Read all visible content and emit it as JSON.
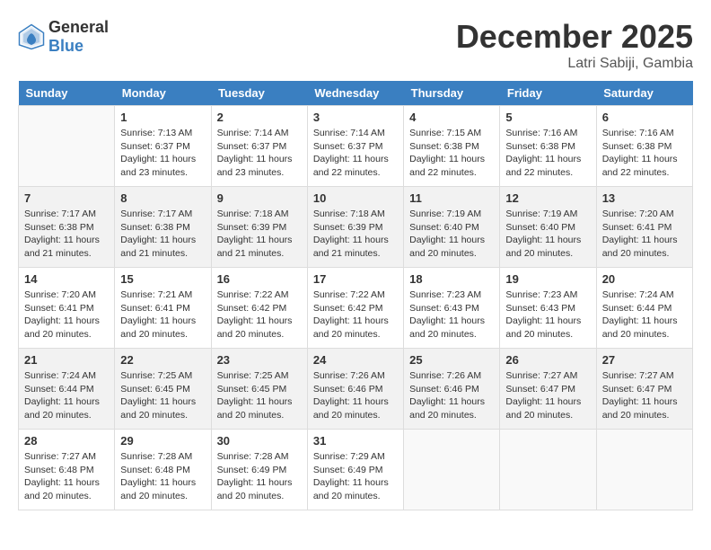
{
  "header": {
    "logo_general": "General",
    "logo_blue": "Blue",
    "month_year": "December 2025",
    "location": "Latri Sabiji, Gambia"
  },
  "weekdays": [
    "Sunday",
    "Monday",
    "Tuesday",
    "Wednesday",
    "Thursday",
    "Friday",
    "Saturday"
  ],
  "weeks": [
    [
      {
        "day": "",
        "sunrise": "",
        "sunset": "",
        "daylight": ""
      },
      {
        "day": "1",
        "sunrise": "Sunrise: 7:13 AM",
        "sunset": "Sunset: 6:37 PM",
        "daylight": "Daylight: 11 hours and 23 minutes."
      },
      {
        "day": "2",
        "sunrise": "Sunrise: 7:14 AM",
        "sunset": "Sunset: 6:37 PM",
        "daylight": "Daylight: 11 hours and 23 minutes."
      },
      {
        "day": "3",
        "sunrise": "Sunrise: 7:14 AM",
        "sunset": "Sunset: 6:37 PM",
        "daylight": "Daylight: 11 hours and 22 minutes."
      },
      {
        "day": "4",
        "sunrise": "Sunrise: 7:15 AM",
        "sunset": "Sunset: 6:38 PM",
        "daylight": "Daylight: 11 hours and 22 minutes."
      },
      {
        "day": "5",
        "sunrise": "Sunrise: 7:16 AM",
        "sunset": "Sunset: 6:38 PM",
        "daylight": "Daylight: 11 hours and 22 minutes."
      },
      {
        "day": "6",
        "sunrise": "Sunrise: 7:16 AM",
        "sunset": "Sunset: 6:38 PM",
        "daylight": "Daylight: 11 hours and 22 minutes."
      }
    ],
    [
      {
        "day": "7",
        "sunrise": "Sunrise: 7:17 AM",
        "sunset": "Sunset: 6:38 PM",
        "daylight": "Daylight: 11 hours and 21 minutes."
      },
      {
        "day": "8",
        "sunrise": "Sunrise: 7:17 AM",
        "sunset": "Sunset: 6:38 PM",
        "daylight": "Daylight: 11 hours and 21 minutes."
      },
      {
        "day": "9",
        "sunrise": "Sunrise: 7:18 AM",
        "sunset": "Sunset: 6:39 PM",
        "daylight": "Daylight: 11 hours and 21 minutes."
      },
      {
        "day": "10",
        "sunrise": "Sunrise: 7:18 AM",
        "sunset": "Sunset: 6:39 PM",
        "daylight": "Daylight: 11 hours and 21 minutes."
      },
      {
        "day": "11",
        "sunrise": "Sunrise: 7:19 AM",
        "sunset": "Sunset: 6:40 PM",
        "daylight": "Daylight: 11 hours and 20 minutes."
      },
      {
        "day": "12",
        "sunrise": "Sunrise: 7:19 AM",
        "sunset": "Sunset: 6:40 PM",
        "daylight": "Daylight: 11 hours and 20 minutes."
      },
      {
        "day": "13",
        "sunrise": "Sunrise: 7:20 AM",
        "sunset": "Sunset: 6:41 PM",
        "daylight": "Daylight: 11 hours and 20 minutes."
      }
    ],
    [
      {
        "day": "14",
        "sunrise": "Sunrise: 7:20 AM",
        "sunset": "Sunset: 6:41 PM",
        "daylight": "Daylight: 11 hours and 20 minutes."
      },
      {
        "day": "15",
        "sunrise": "Sunrise: 7:21 AM",
        "sunset": "Sunset: 6:41 PM",
        "daylight": "Daylight: 11 hours and 20 minutes."
      },
      {
        "day": "16",
        "sunrise": "Sunrise: 7:22 AM",
        "sunset": "Sunset: 6:42 PM",
        "daylight": "Daylight: 11 hours and 20 minutes."
      },
      {
        "day": "17",
        "sunrise": "Sunrise: 7:22 AM",
        "sunset": "Sunset: 6:42 PM",
        "daylight": "Daylight: 11 hours and 20 minutes."
      },
      {
        "day": "18",
        "sunrise": "Sunrise: 7:23 AM",
        "sunset": "Sunset: 6:43 PM",
        "daylight": "Daylight: 11 hours and 20 minutes."
      },
      {
        "day": "19",
        "sunrise": "Sunrise: 7:23 AM",
        "sunset": "Sunset: 6:43 PM",
        "daylight": "Daylight: 11 hours and 20 minutes."
      },
      {
        "day": "20",
        "sunrise": "Sunrise: 7:24 AM",
        "sunset": "Sunset: 6:44 PM",
        "daylight": "Daylight: 11 hours and 20 minutes."
      }
    ],
    [
      {
        "day": "21",
        "sunrise": "Sunrise: 7:24 AM",
        "sunset": "Sunset: 6:44 PM",
        "daylight": "Daylight: 11 hours and 20 minutes."
      },
      {
        "day": "22",
        "sunrise": "Sunrise: 7:25 AM",
        "sunset": "Sunset: 6:45 PM",
        "daylight": "Daylight: 11 hours and 20 minutes."
      },
      {
        "day": "23",
        "sunrise": "Sunrise: 7:25 AM",
        "sunset": "Sunset: 6:45 PM",
        "daylight": "Daylight: 11 hours and 20 minutes."
      },
      {
        "day": "24",
        "sunrise": "Sunrise: 7:26 AM",
        "sunset": "Sunset: 6:46 PM",
        "daylight": "Daylight: 11 hours and 20 minutes."
      },
      {
        "day": "25",
        "sunrise": "Sunrise: 7:26 AM",
        "sunset": "Sunset: 6:46 PM",
        "daylight": "Daylight: 11 hours and 20 minutes."
      },
      {
        "day": "26",
        "sunrise": "Sunrise: 7:27 AM",
        "sunset": "Sunset: 6:47 PM",
        "daylight": "Daylight: 11 hours and 20 minutes."
      },
      {
        "day": "27",
        "sunrise": "Sunrise: 7:27 AM",
        "sunset": "Sunset: 6:47 PM",
        "daylight": "Daylight: 11 hours and 20 minutes."
      }
    ],
    [
      {
        "day": "28",
        "sunrise": "Sunrise: 7:27 AM",
        "sunset": "Sunset: 6:48 PM",
        "daylight": "Daylight: 11 hours and 20 minutes."
      },
      {
        "day": "29",
        "sunrise": "Sunrise: 7:28 AM",
        "sunset": "Sunset: 6:48 PM",
        "daylight": "Daylight: 11 hours and 20 minutes."
      },
      {
        "day": "30",
        "sunrise": "Sunrise: 7:28 AM",
        "sunset": "Sunset: 6:49 PM",
        "daylight": "Daylight: 11 hours and 20 minutes."
      },
      {
        "day": "31",
        "sunrise": "Sunrise: 7:29 AM",
        "sunset": "Sunset: 6:49 PM",
        "daylight": "Daylight: 11 hours and 20 minutes."
      },
      {
        "day": "",
        "sunrise": "",
        "sunset": "",
        "daylight": ""
      },
      {
        "day": "",
        "sunrise": "",
        "sunset": "",
        "daylight": ""
      },
      {
        "day": "",
        "sunrise": "",
        "sunset": "",
        "daylight": ""
      }
    ]
  ]
}
